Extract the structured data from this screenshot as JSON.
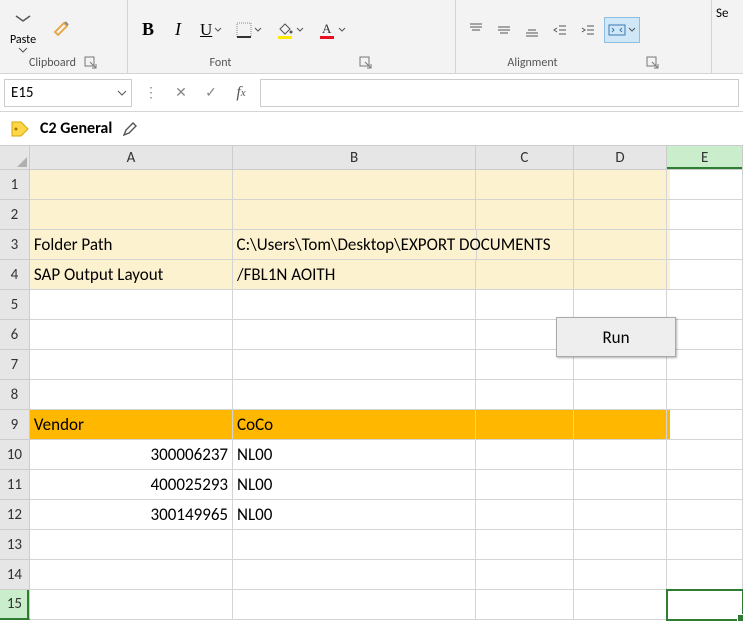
{
  "ribbon": {
    "paste_label": "Paste",
    "groups": {
      "clipboard": "Clipboard",
      "font": "Font",
      "alignment": "Alignment"
    },
    "tail": "Se"
  },
  "namebox": {
    "cell_ref": "E15",
    "formula": ""
  },
  "sensitivity": {
    "label": "C2 General"
  },
  "columns": [
    "A",
    "B",
    "C",
    "D",
    "E"
  ],
  "rowHeaders": [
    "1",
    "2",
    "3",
    "4",
    "5",
    "6",
    "7",
    "8",
    "9",
    "10",
    "11",
    "12",
    "13",
    "14",
    "15"
  ],
  "button": {
    "run": "Run"
  },
  "cells": {
    "r3A": "Folder Path",
    "r3B": "C:\\Users\\Tom\\Desktop\\EXPORT DOCUMENTS",
    "r4A": "SAP Output Layout",
    "r4B": "/FBL1N AOITH",
    "r9A": "Vendor",
    "r9B": "CoCo",
    "r10A": "300006237",
    "r10B": "NL00",
    "r11A": "400025293",
    "r11B": "NL00",
    "r12A": "300149965",
    "r12B": "NL00"
  },
  "chart_data": {
    "type": "table",
    "title": "",
    "columns": [
      "Vendor",
      "CoCo"
    ],
    "rows": [
      [
        300006237,
        "NL00"
      ],
      [
        400025293,
        "NL00"
      ],
      [
        300149965,
        "NL00"
      ]
    ],
    "params": {
      "Folder Path": "C:\\Users\\Tom\\Desktop\\EXPORT DOCUMENTS",
      "SAP Output Layout": "/FBL1N AOITH"
    }
  }
}
